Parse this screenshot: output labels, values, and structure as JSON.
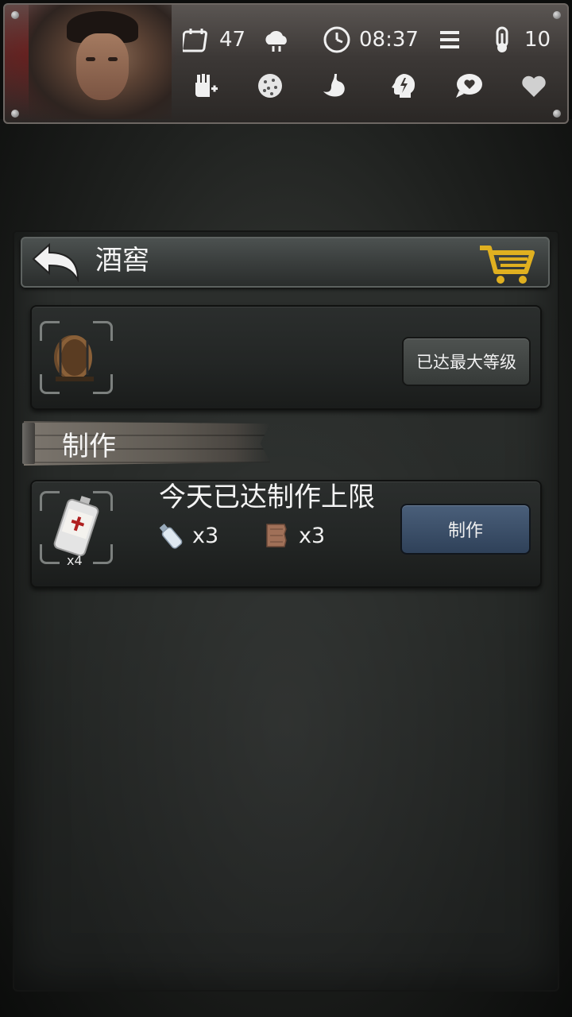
{
  "status": {
    "day": "47",
    "time": "08:37",
    "temperature": "10"
  },
  "header": {
    "title": "酒窖"
  },
  "building": {
    "button_label": "已达最大等级"
  },
  "section": {
    "title": "制作"
  },
  "recipe": {
    "title": "今天已达制作上限",
    "result_count": "x4",
    "ingredients": [
      {
        "icon": "bottle-icon",
        "qty": "x3"
      },
      {
        "icon": "wood-plank-icon",
        "qty": "x3"
      }
    ],
    "craft_button": "制作"
  },
  "colors": {
    "craft_button": "#3d5069",
    "blood": "#8c0a0a"
  }
}
